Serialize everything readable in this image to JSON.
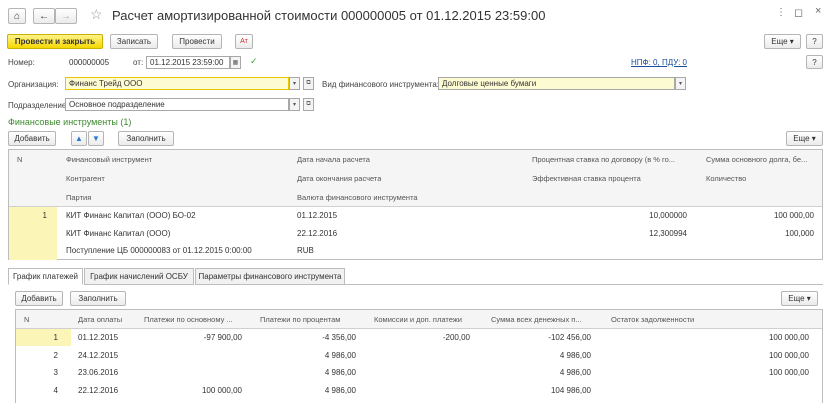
{
  "title": "Расчет амортизированной стоимости 000000005 от 01.12.2015 23:59:00",
  "toolbar": {
    "post_close": "Провести и закрыть",
    "save": "Записать",
    "post": "Провести",
    "more": "Еще",
    "nds_link": "НПФ: 0, ПДУ: 0"
  },
  "header": {
    "number_label": "Номер:",
    "number_value": "000000005",
    "date_label": "от:",
    "date_value": "01.12.2015 23:59:00",
    "org_label": "Организация:",
    "org_value": "Финанс Трейд ООО",
    "fin_type_label": "Вид финансового инструмента:",
    "fin_type_value": "Долговые ценные бумаги",
    "dept_label": "Подразделение:",
    "dept_value": "Основное подразделение"
  },
  "fin_instruments": {
    "section_title": "Финансовые инструменты (1)",
    "add": "Добавить",
    "fill": "Заполнить",
    "more": "Еще",
    "headers": {
      "n": "N",
      "instrument": "Финансовый инструмент",
      "start_date": "Дата начала расчета",
      "rate": "Процентная ставка по договору (в % го...",
      "principal": "Сумма основного долга, бе...",
      "counterparty": "Контрагент",
      "end_date": "Дата окончания расчета",
      "eff_rate": "Эффективная ставка процента",
      "qty": "Количество",
      "batch": "Партия",
      "currency": "Валюта финансового инструмента"
    },
    "row": {
      "n": "1",
      "instrument": "КИТ Финанс Капитал (ООО) БО-02",
      "start_date": "01.12.2015",
      "rate": "10,000000",
      "principal": "100 000,00",
      "counterparty": "КИТ Финанс Капитал (ООО)",
      "end_date": "22.12.2016",
      "eff_rate": "12,300994",
      "qty": "100,000",
      "batch": "Поступление ЦБ 000000083 от 01.12.2015 0:00:00",
      "currency": "RUB"
    }
  },
  "tabs": [
    "График платежей",
    "График начислений ОСБУ",
    "Параметры финансового инструмента"
  ],
  "payments": {
    "add": "Добавить",
    "fill": "Заполнить",
    "more": "Еще",
    "headers": [
      "N",
      "Дата оплаты",
      "Платежи по основному ...",
      "Платежи по процентам",
      "Комиссии и доп. платежи",
      "Сумма всех денежных п...",
      "Остаток задолженности"
    ],
    "rows": [
      [
        "1",
        "01.12.2015",
        "-97 900,00",
        "-4 356,00",
        "-200,00",
        "-102 456,00",
        "100 000,00"
      ],
      [
        "2",
        "24.12.2015",
        "",
        "4 986,00",
        "",
        "4 986,00",
        "100 000,00"
      ],
      [
        "3",
        "23.06.2016",
        "",
        "4 986,00",
        "",
        "4 986,00",
        "100 000,00"
      ],
      [
        "4",
        "22.12.2016",
        "100 000,00",
        "4 986,00",
        "",
        "104 986,00",
        ""
      ]
    ]
  }
}
